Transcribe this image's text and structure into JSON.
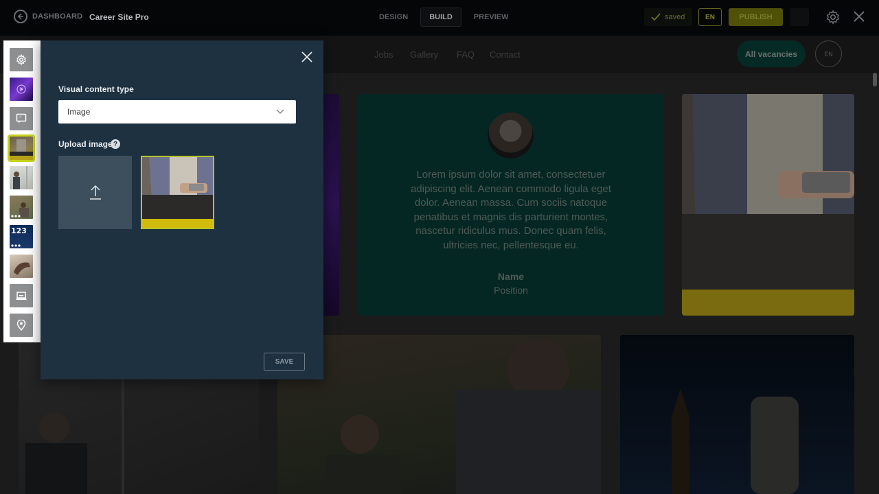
{
  "topbar": {
    "dashboard_label": "DASHBOARD",
    "site_name": "Career Site Pro",
    "modes": [
      {
        "label": "DESIGN",
        "active": false
      },
      {
        "label": "BUILD",
        "active": true
      },
      {
        "label": "PREVIEW",
        "active": false
      }
    ],
    "saved_label": "saved",
    "language": "EN",
    "publish_label": "PUBLISH"
  },
  "site": {
    "nav": [
      "Jobs",
      "Gallery",
      "FAQ",
      "Contact"
    ],
    "vacancies_label": "All vacancies",
    "language": "EN",
    "testimonial": {
      "text": "Lorem ipsum dolor sit amet, consectetuer adipiscing elit. Aenean commodo ligula eget dolor. Aenean massa. Cum sociis natoque penatibus et magnis dis parturient montes, nascetur ridiculus mus. Donec quam felis, ultricies nec, pellentesque eu.",
      "name": "Name",
      "position": "Position"
    }
  },
  "sections": [
    {
      "name": "settings-icon",
      "type": "icon"
    },
    {
      "name": "video-thumbnail",
      "type": "image"
    },
    {
      "name": "quote-icon",
      "type": "icon"
    },
    {
      "name": "image-thumbnail-active",
      "type": "image",
      "active": true
    },
    {
      "name": "people-thumbnail",
      "type": "image"
    },
    {
      "name": "gallery-thumbnail",
      "type": "image"
    },
    {
      "name": "numbers-thumbnail",
      "type": "image",
      "label": "123"
    },
    {
      "name": "hand-thumbnail",
      "type": "image"
    },
    {
      "name": "laptop-icon",
      "type": "icon"
    },
    {
      "name": "location-pin-icon",
      "type": "icon"
    }
  ],
  "panel": {
    "content_type_label": "Visual content type",
    "content_type_value": "Image",
    "upload_label": "Upload image",
    "help_glyph": "?",
    "save_label": "SAVE"
  },
  "colors": {
    "accent": "#c7d41a",
    "panel_bg": "#1e3140",
    "teal": "#052723"
  }
}
